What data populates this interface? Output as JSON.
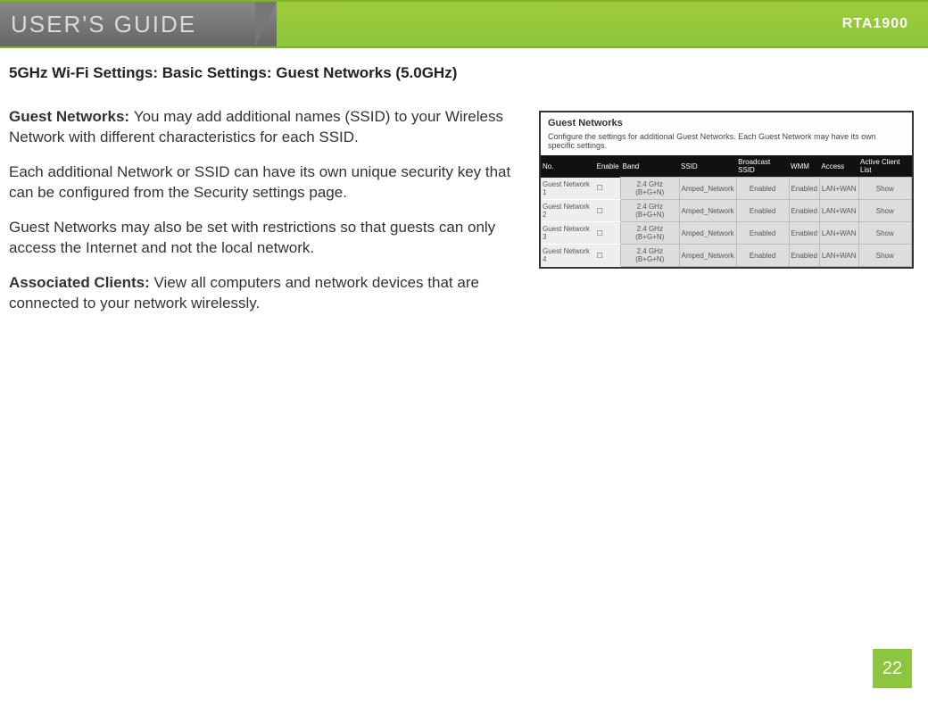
{
  "header": {
    "guide_label": "USER'S GUIDE",
    "model": "RTA1900"
  },
  "title": "5GHz Wi-Fi Settings: Basic Settings: Guest Networks (5.0GHz)",
  "paragraphs": {
    "p1_lead": "Guest Networks: ",
    "p1_body": "You may add additional names (SSID) to your Wireless Network with different characteristics for each SSID.",
    "p2_body": "Each additional Network or SSID can have its own unique security key that can be configured from the Security settings page.",
    "p3_body": "Guest Networks may also be set with restrictions so that guests can only access the Internet and not the local network.",
    "p4_lead": "Associated Clients: ",
    "p4_body": "View all computers and network devices that are connected to your network wirelessly."
  },
  "inset": {
    "heading": "Guest Networks",
    "sub": "Configure the settings for additional Guest Networks. Each Guest Network may have its own specific settings.",
    "columns": {
      "c0": "No.",
      "c1": "Enable",
      "c2": "Band",
      "c3": "SSID",
      "c4": "Broadcast SSID",
      "c5": "WMM",
      "c6": "Access",
      "c7": "Active Client List"
    },
    "rows": [
      {
        "no": "Guest Network 1",
        "enable": "",
        "band": "2.4 GHz (B+G+N)",
        "ssid": "Amped_Network",
        "bssid": "Enabled",
        "wmm": "Enabled",
        "access": "LAN+WAN",
        "acl": "Show"
      },
      {
        "no": "Guest Network 2",
        "enable": "",
        "band": "2.4 GHz (B+G+N)",
        "ssid": "Amped_Network",
        "bssid": "Enabled",
        "wmm": "Enabled",
        "access": "LAN+WAN",
        "acl": "Show"
      },
      {
        "no": "Guest Network 3",
        "enable": "",
        "band": "2.4 GHz (B+G+N)",
        "ssid": "Amped_Network",
        "bssid": "Enabled",
        "wmm": "Enabled",
        "access": "LAN+WAN",
        "acl": "Show"
      },
      {
        "no": "Guest Network 4",
        "enable": "",
        "band": "2.4 GHz (B+G+N)",
        "ssid": "Amped_Network",
        "bssid": "Enabled",
        "wmm": "Enabled",
        "access": "LAN+WAN",
        "acl": "Show"
      }
    ]
  },
  "page_number": "22"
}
